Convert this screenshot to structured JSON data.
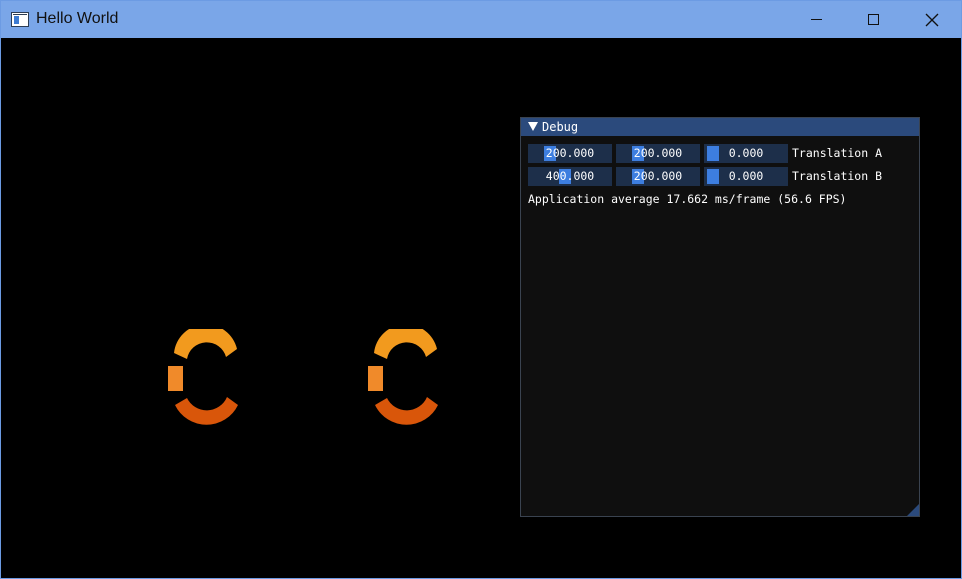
{
  "window": {
    "title": "Hello World",
    "icon": "window-app-icon",
    "controls": [
      "minimize-icon",
      "maximize-icon",
      "close-icon"
    ],
    "close_glyph": "✕"
  },
  "viewport": {
    "background": "#000000",
    "logo_colors": {
      "top": "#f29a1e",
      "left": "#f08a2a",
      "bottom": "#d9560a"
    }
  },
  "debug": {
    "title": "Debug",
    "title_bar_color": "#2b4a7c",
    "translation_a": {
      "label": "Translation A",
      "values": [
        "200.000",
        "200.000",
        "0.000"
      ]
    },
    "translation_b": {
      "label": "Translation B",
      "values": [
        "400.000",
        "200.000",
        "0.000"
      ]
    },
    "fps_text": "Application average 17.662 ms/frame (56.6 FPS)"
  }
}
